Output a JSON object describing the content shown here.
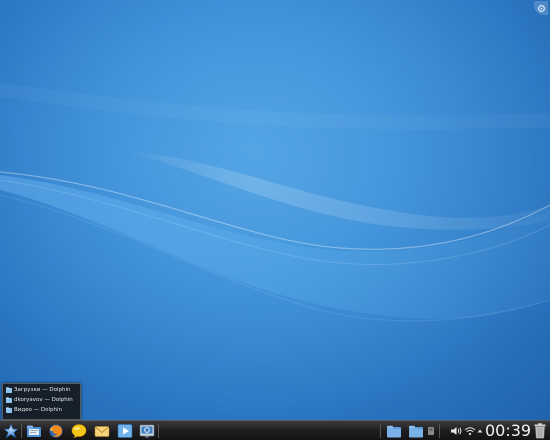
{
  "taskbar_popup": {
    "items": [
      {
        "label": "Загрузки — Dolphin"
      },
      {
        "label": "dkoryavov — Dolphin"
      },
      {
        "label": "Видео — Dolphin"
      }
    ]
  },
  "panel": {
    "launchers": [
      {
        "icon": "kickoff-menu-icon"
      },
      {
        "icon": "file-manager-icon"
      },
      {
        "icon": "firefox-icon"
      },
      {
        "icon": "chat-icon"
      },
      {
        "icon": "mail-icon"
      },
      {
        "icon": "media-player-icon"
      },
      {
        "icon": "system-settings-icon"
      }
    ],
    "tray_icons": [
      "folder-icon",
      "folder-icon",
      "device-notifier-icon",
      "volume-icon",
      "network-icon",
      "tray-expand-icon"
    ],
    "clock": "00:39",
    "trash_icon": "trash-icon"
  },
  "colors": {
    "desktop_bg": "#2f7fc9",
    "panel_bg": "#1c1c1e",
    "accent": "#4a9de0"
  }
}
